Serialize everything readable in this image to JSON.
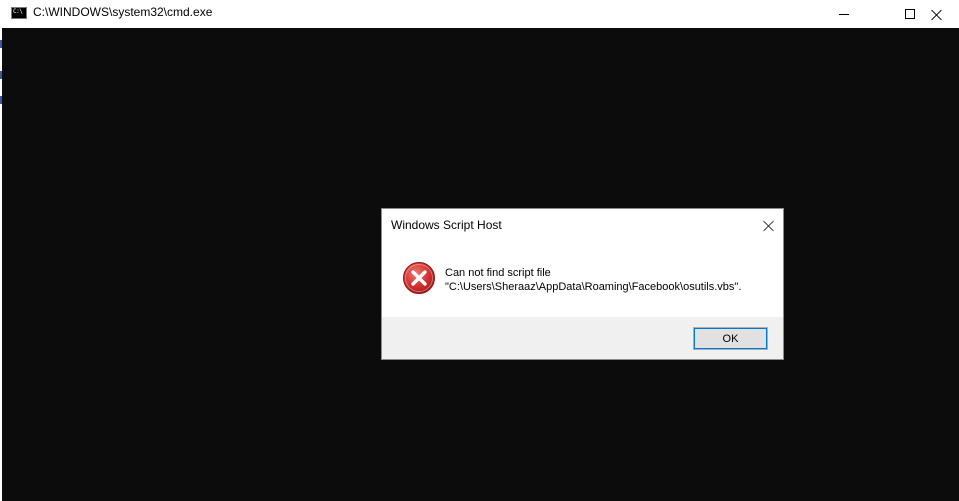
{
  "window": {
    "title": "C:\\WINDOWS\\system32\\cmd.exe",
    "icon": "cmd-icon",
    "icon_text": "C:\\"
  },
  "dialog": {
    "title": "Windows Script Host",
    "icon": "error-icon",
    "message_line1": "Can not find script file",
    "message_line2": "\"C:\\Users\\Sheraaz\\AppData\\Roaming\\Facebook\\osutils.vbs\".",
    "ok_label": "OK"
  },
  "colors": {
    "console_background": "#0c0c0c",
    "error_red": "#d32f2f",
    "dialog_footer": "#f0f0f0",
    "focus_border": "#0078d7"
  }
}
